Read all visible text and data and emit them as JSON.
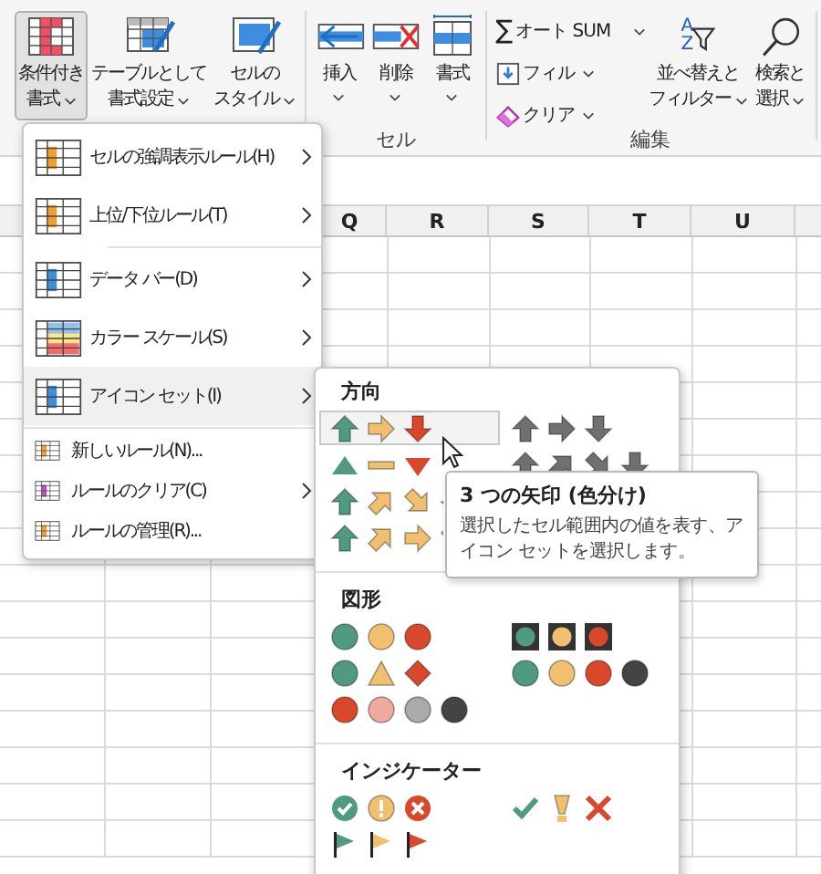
{
  "ribbon": {
    "groups": [
      {
        "buttons": [
          {
            "kind": "conditional",
            "lines": [
              "条件付き",
              "書式"
            ],
            "dropdown": true,
            "selected": true
          },
          {
            "kind": "table",
            "lines": [
              "テーブルとして",
              "書式設定"
            ],
            "dropdown": true,
            "selected": false
          },
          {
            "kind": "cellstyle",
            "lines": [
              "セルの",
              "スタイル"
            ],
            "dropdown": true,
            "selected": false
          }
        ]
      },
      {
        "label": "セル",
        "buttons": [
          {
            "kind": "insert",
            "lines": [
              "挿入"
            ],
            "dropdown": true,
            "selected": false
          },
          {
            "kind": "delete",
            "lines": [
              "削除"
            ],
            "dropdown": true,
            "selected": false
          },
          {
            "kind": "format",
            "lines": [
              "書式"
            ],
            "dropdown": true,
            "selected": false
          }
        ]
      },
      {
        "label": "編集",
        "small": [
          {
            "kind": "autosum",
            "symbol": "∑",
            "label": "オート SUM",
            "dropdown": true
          },
          {
            "kind": "fill",
            "label": "フィル",
            "dropdown": true
          },
          {
            "kind": "clear",
            "label": "クリア",
            "dropdown": true
          }
        ],
        "buttons": [
          {
            "kind": "sort",
            "icon_letters": [
              "A",
              "Z"
            ],
            "lines": [
              "並べ替えと",
              "フィルター"
            ],
            "dropdown": true,
            "selected": false
          },
          {
            "kind": "find",
            "lines": [
              "検索と",
              "選択"
            ],
            "dropdown": true,
            "selected": false
          }
        ]
      }
    ]
  },
  "sheet": {
    "columns": [
      "Q",
      "R",
      "S",
      "T",
      "U"
    ]
  },
  "menu": {
    "sections": [
      [
        {
          "kind": "highlight",
          "label": "セルの強調表示ルール(H)",
          "submenu": true,
          "selected": false
        },
        {
          "kind": "topbottom",
          "label": "上位/下位ルール(T)",
          "submenu": true,
          "selected": false
        }
      ],
      [
        {
          "kind": "databar",
          "label": "データ バー(D)",
          "submenu": true,
          "selected": false
        },
        {
          "kind": "colorscale",
          "label": "カラー スケール(S)",
          "submenu": true,
          "selected": false
        },
        {
          "kind": "iconset",
          "label": "アイコン セット(I)",
          "submenu": true,
          "selected": true
        }
      ],
      [
        {
          "kind": "new",
          "label": "新しいルール(N)...",
          "submenu": false,
          "selected": false
        },
        {
          "kind": "clear",
          "label": "ルールのクリア(C)",
          "submenu": true,
          "selected": false
        },
        {
          "kind": "manage",
          "label": "ルールの管理(R)...",
          "submenu": false,
          "selected": false
        }
      ]
    ]
  },
  "submenu": {
    "sections": [
      {
        "title": "方向",
        "rows": [
          [
            {
              "kind": "arrows3",
              "selected": true
            },
            {
              "kind": "arrows3gray",
              "selected": false
            }
          ],
          [
            {
              "kind": "triangles3",
              "selected": false
            },
            {
              "kind": "arrows4gray",
              "selected": false
            }
          ],
          [
            {
              "kind": "arrows4",
              "selected": false
            }
          ],
          [
            {
              "kind": "arrows5",
              "selected": false
            }
          ]
        ]
      },
      {
        "title": "図形",
        "rows": [
          [
            {
              "kind": "lights3",
              "selected": false
            },
            {
              "kind": "lights3rimmed",
              "selected": false
            }
          ],
          [
            {
              "kind": "signs3",
              "selected": false
            },
            {
              "kind": "lights4",
              "selected": false
            }
          ],
          [
            {
              "kind": "redtoblack",
              "selected": false
            }
          ]
        ]
      },
      {
        "title": "インジケーター",
        "rows": [
          [
            {
              "kind": "symbols3circled",
              "selected": false
            },
            {
              "kind": "symbols3",
              "selected": false
            }
          ],
          [
            {
              "kind": "flags3",
              "selected": false
            }
          ]
        ]
      }
    ]
  },
  "tooltip": {
    "title": "3 つの矢印 (色分け)",
    "text": "選択したセル範囲内の値を表す、アイコン セットを選択します。"
  }
}
